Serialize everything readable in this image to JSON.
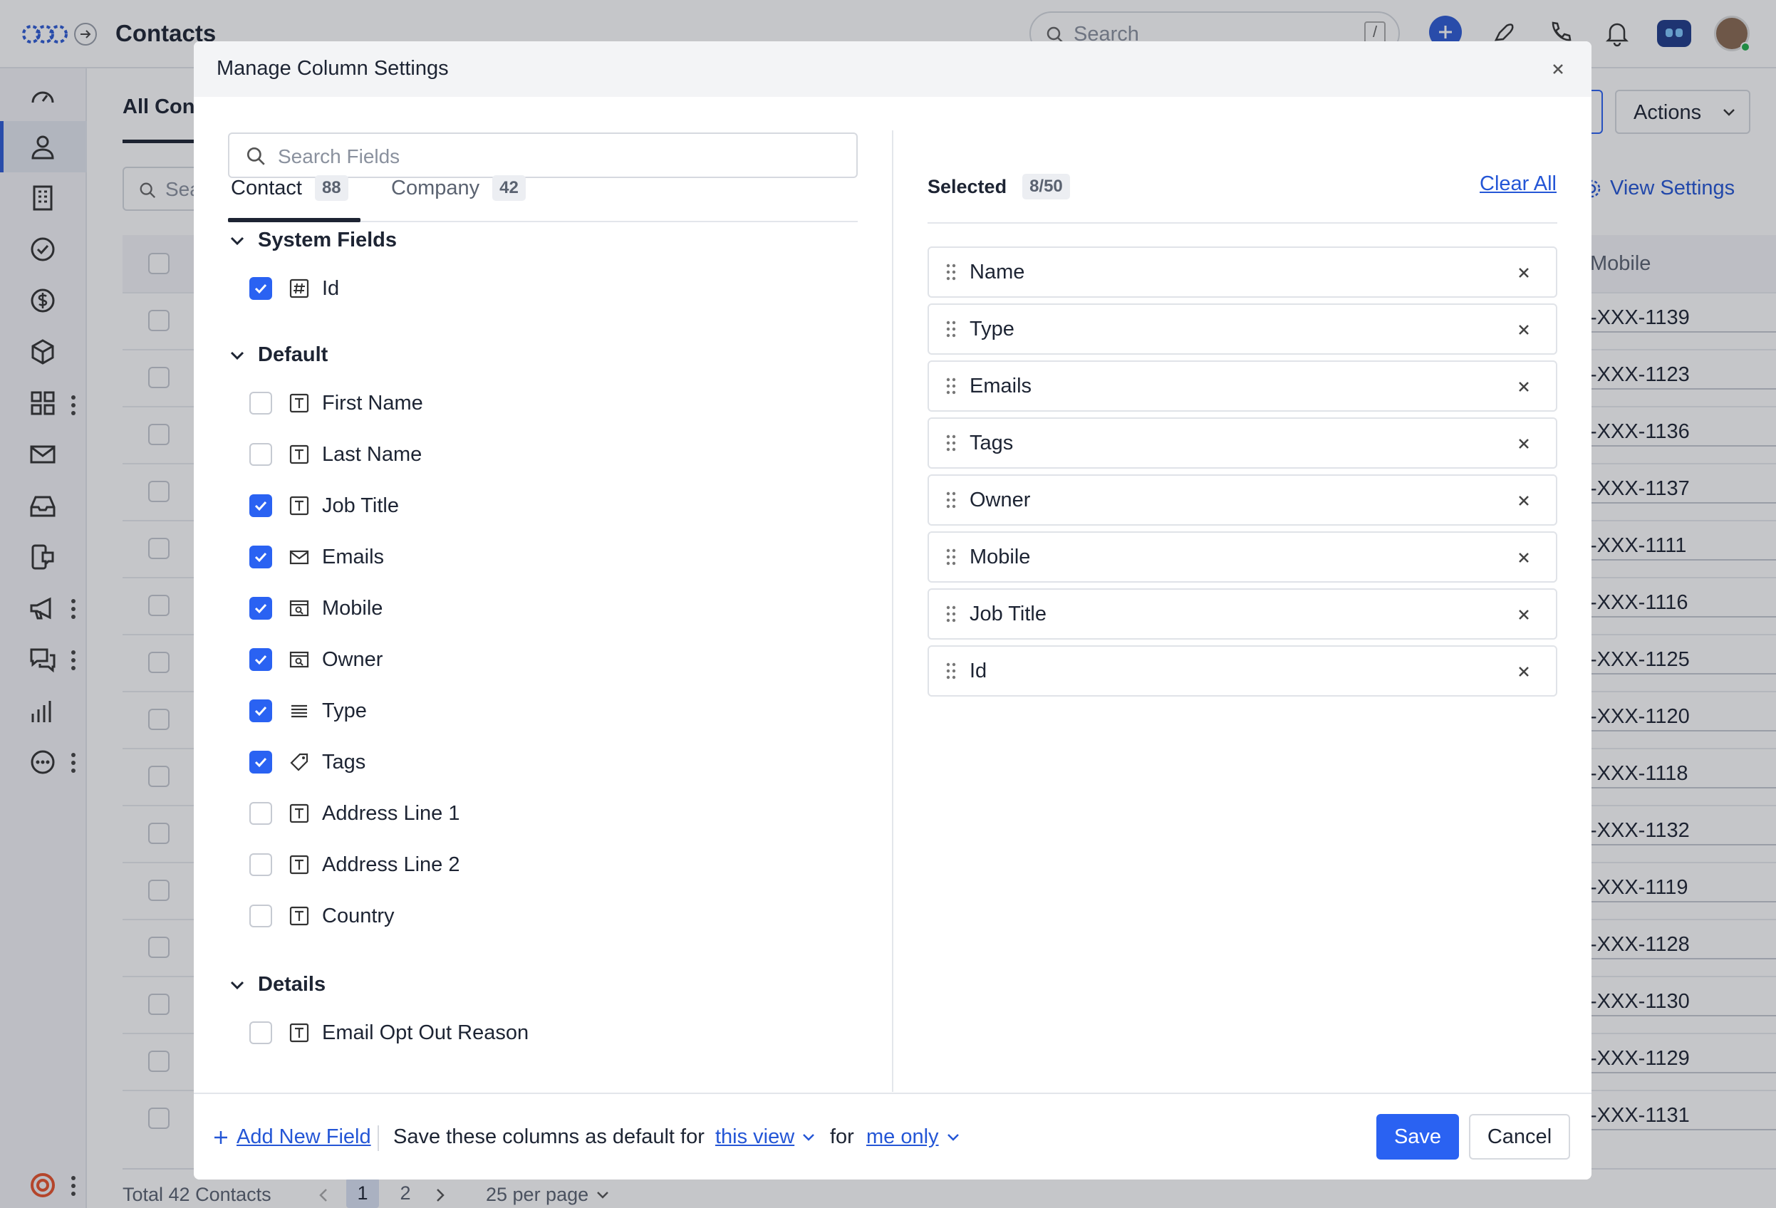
{
  "app": {
    "page_title": "Contacts",
    "search_placeholder": "Search",
    "search_shortcut": "/",
    "view_tab": "All Cont",
    "list_search_placeholder": "Sea",
    "actions_label": "Actions",
    "view_settings_label": "View Settings",
    "column_header": "Mobile",
    "phones": [
      "-XXX-1139",
      "-XXX-1123",
      "-XXX-1136",
      "-XXX-1137",
      "-XXX-1111",
      "-XXX-1116",
      "-XXX-1125",
      "-XXX-1120",
      "-XXX-1118",
      "-XXX-1132",
      "-XXX-1119",
      "-XXX-1128",
      "-XXX-1130",
      "-XXX-1129",
      "-XXX-1131"
    ],
    "pagination": {
      "total": "Total 42 Contacts",
      "pages": [
        "1",
        "2"
      ],
      "current": "1",
      "per_page": "25 per page"
    },
    "sidebar_icons": [
      "speedometer-icon",
      "user-icon",
      "building-icon",
      "check-circle-icon",
      "dollar-icon",
      "box-icon",
      "apps-icon",
      "mail-icon",
      "inbox-icon",
      "device-chat-icon",
      "megaphone-icon",
      "chat-icon",
      "bar-chart-icon",
      "more-icon",
      "help-icon"
    ],
    "accent": "#2a62f2"
  },
  "modal": {
    "title": "Manage Column Settings",
    "search_placeholder": "Search Fields",
    "tabs": [
      {
        "label": "Contact",
        "count": "88",
        "active": true
      },
      {
        "label": "Company",
        "count": "42",
        "active": false
      }
    ],
    "sections": [
      {
        "title": "System Fields",
        "fields": [
          {
            "label": "Id",
            "icon": "hash-icon",
            "checked": true
          }
        ]
      },
      {
        "title": "Default",
        "fields": [
          {
            "label": "First Name",
            "icon": "text-icon",
            "checked": false
          },
          {
            "label": "Last Name",
            "icon": "text-icon",
            "checked": false
          },
          {
            "label": "Job Title",
            "icon": "text-icon",
            "checked": true
          },
          {
            "label": "Emails",
            "icon": "mail-icon",
            "checked": true
          },
          {
            "label": "Mobile",
            "icon": "lookup-icon",
            "checked": true
          },
          {
            "label": "Owner",
            "icon": "lookup-icon",
            "checked": true
          },
          {
            "label": "Type",
            "icon": "list-icon",
            "checked": true
          },
          {
            "label": "Tags",
            "icon": "tag-icon",
            "checked": true
          },
          {
            "label": "Address Line 1",
            "icon": "text-icon",
            "checked": false
          },
          {
            "label": "Address Line 2",
            "icon": "text-icon",
            "checked": false
          },
          {
            "label": "Country",
            "icon": "text-icon",
            "checked": false
          }
        ]
      },
      {
        "title": "Details",
        "fields": [
          {
            "label": "Email Opt Out Reason",
            "icon": "text-icon",
            "checked": false
          }
        ]
      }
    ],
    "selected_label": "Selected",
    "selected_count": "8/50",
    "clear_all": "Clear All",
    "selected_items": [
      "Name",
      "Type",
      "Emails",
      "Tags",
      "Owner",
      "Mobile",
      "Job Title",
      "Id"
    ],
    "footer": {
      "add_field": "Add New Field",
      "save_text": "Save these columns as default for",
      "scope": "this view",
      "for_text": "for",
      "audience": "me only",
      "save": "Save",
      "cancel": "Cancel"
    }
  }
}
